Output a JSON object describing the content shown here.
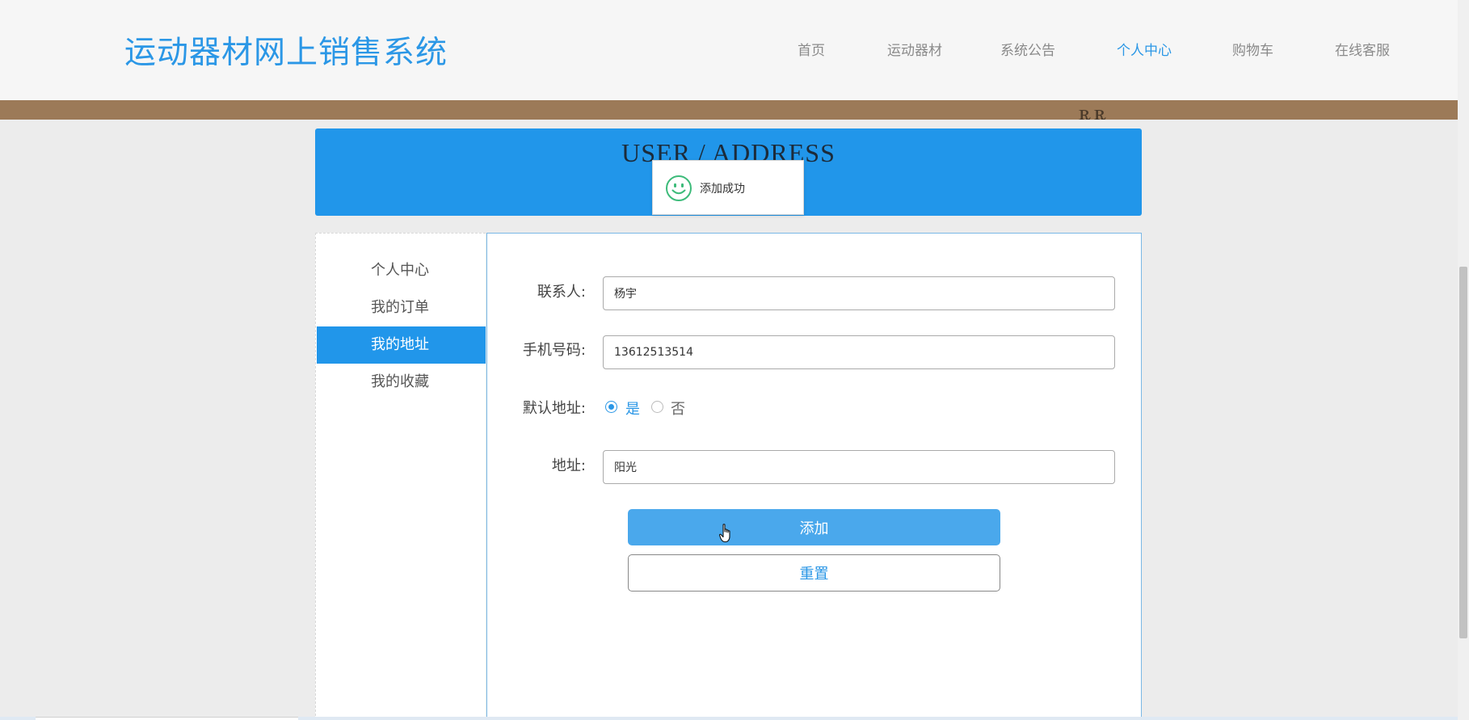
{
  "brand": "运动器材网上销售系统",
  "nav": [
    {
      "label": "首页",
      "active": false
    },
    {
      "label": "运动器材",
      "active": false
    },
    {
      "label": "系统公告",
      "active": false
    },
    {
      "label": "个人中心",
      "active": true
    },
    {
      "label": "购物车",
      "active": false
    },
    {
      "label": "在线客服",
      "active": false
    }
  ],
  "page_title": "USER / ADDRESS",
  "toast": {
    "message": "添加成功",
    "icon": "smiley-icon"
  },
  "sidebar": {
    "items": [
      {
        "label": "个人中心",
        "active": false
      },
      {
        "label": "我的订单",
        "active": false
      },
      {
        "label": "我的地址",
        "active": true
      },
      {
        "label": "我的收藏",
        "active": false
      }
    ]
  },
  "form": {
    "contact_label": "联系人:",
    "contact_value": "杨宇",
    "phone_label": "手机号码:",
    "phone_value": "13612513514",
    "default_label": "默认地址:",
    "default_yes": "是",
    "default_no": "否",
    "default_selected": "是",
    "address_label": "地址:",
    "address_value": "阳光",
    "add_button": "添加",
    "reset_button": "重置"
  },
  "colors": {
    "accent": "#2196ea",
    "brand": "#2b97e6",
    "banner": "#9c7a58",
    "button": "#4aa8ec"
  }
}
